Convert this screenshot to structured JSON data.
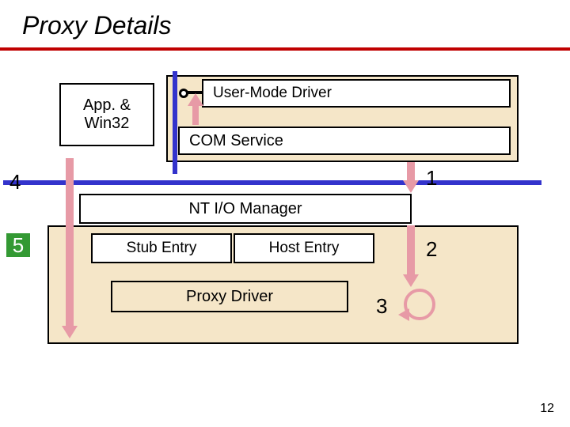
{
  "slide": {
    "title": "Proxy Details",
    "page_number": "12"
  },
  "boxes": {
    "app_win32": "App. &\nWin32",
    "user_mode_driver": "User-Mode Driver",
    "com_service": "COM Service",
    "nt_io_manager": "NT I/O Manager",
    "stub_entry": "Stub Entry",
    "host_entry": "Host Entry",
    "proxy_driver": "Proxy Driver"
  },
  "labels": {
    "n1": "1",
    "n2": "2",
    "n3": "3",
    "n4": "4",
    "n5": "5"
  }
}
